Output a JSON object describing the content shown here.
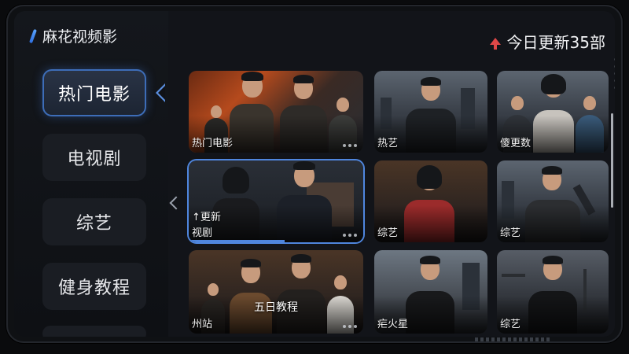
{
  "app": {
    "title": "麻花视频影"
  },
  "header": {
    "updates_text": "今日更新35部",
    "update_icon": "up-arrow-icon",
    "accent": "#e04848"
  },
  "sidebar": {
    "items": [
      {
        "label": "热门电影",
        "active": true
      },
      {
        "label": "电视剧",
        "active": false
      },
      {
        "label": "综艺",
        "active": false
      },
      {
        "label": "健身教程",
        "active": false
      }
    ]
  },
  "grid": {
    "cards": [
      {
        "label": "热门电影",
        "focused": false
      },
      {
        "label": "热艺"
      },
      {
        "label": "傻更数"
      },
      {
        "label": "视剧",
        "overlay": "↑更新",
        "focused": true,
        "progress": 0.55
      },
      {
        "label": "综艺"
      },
      {
        "label": "综艺"
      },
      {
        "label": "州站",
        "overlay": "五日教程"
      },
      {
        "label": "疟火星"
      },
      {
        "label": "综艺"
      }
    ]
  },
  "colors": {
    "accent": "#4f86de",
    "background": "#101217"
  }
}
